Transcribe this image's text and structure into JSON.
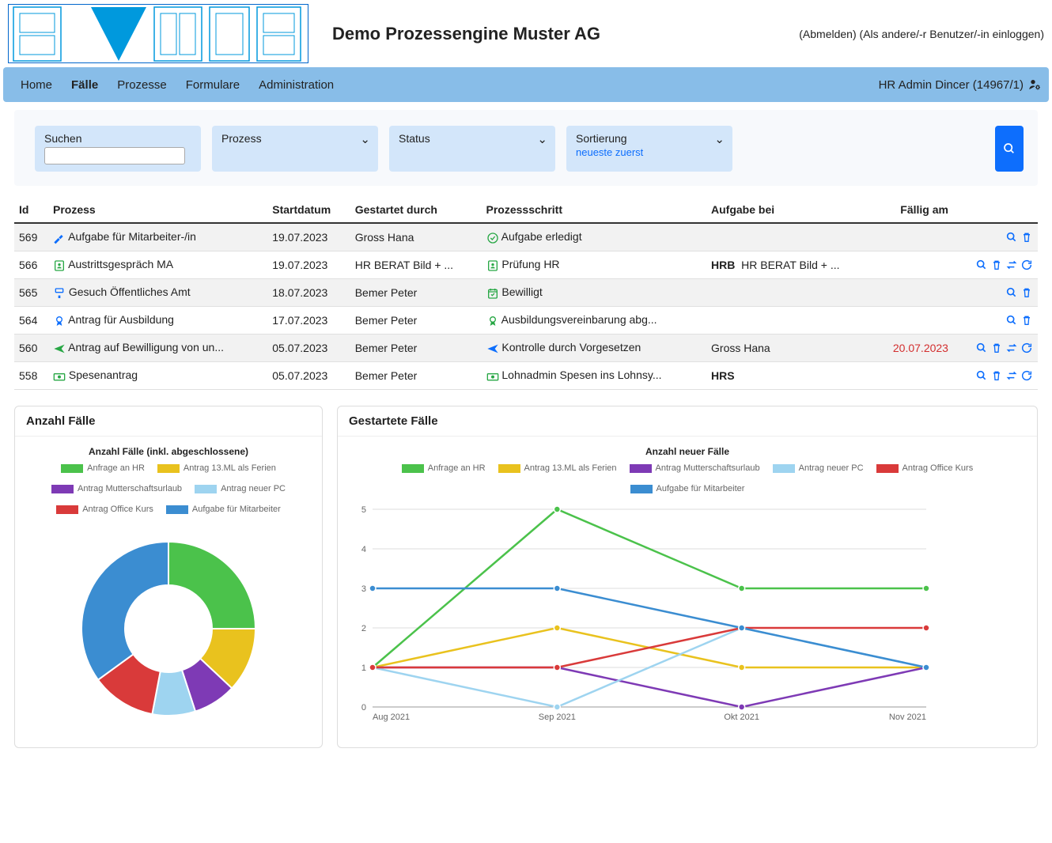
{
  "header": {
    "company": "Demo Prozessengine Muster AG",
    "logout": "(Abmelden)",
    "login_as": "(Als andere/-r Benutzer/-in einloggen)"
  },
  "nav": {
    "items": [
      "Home",
      "Fälle",
      "Prozesse",
      "Formulare",
      "Administration"
    ],
    "active_index": 1,
    "user": "HR Admin Dincer (14967/1)"
  },
  "filters": {
    "search_label": "Suchen",
    "process_label": "Prozess",
    "status_label": "Status",
    "sort_label": "Sortierung",
    "sort_value": "neueste zuerst"
  },
  "table": {
    "columns": [
      "Id",
      "Prozess",
      "Startdatum",
      "Gestartet durch",
      "Prozessschritt",
      "Aufgabe bei",
      "Fällig am"
    ],
    "rows": [
      {
        "id": "569",
        "prozess": "Aufgabe für Mitarbeiter-/in",
        "icon": "hammer",
        "icon_color": "#0d6efd",
        "start": "19.07.2023",
        "starter": "Gross Hana",
        "step": "Aufgabe erledigt",
        "step_icon": "check-circle",
        "step_color": "#28a745",
        "assignee_code": "",
        "assignee": "",
        "due": "",
        "overdue": false,
        "actions": [
          "search",
          "trash"
        ]
      },
      {
        "id": "566",
        "prozess": "Austrittsgespräch MA",
        "icon": "doc-user",
        "icon_color": "#28a745",
        "start": "19.07.2023",
        "starter": "HR BERAT Bild + ...",
        "step": "Prüfung HR",
        "step_icon": "doc-user",
        "step_color": "#28a745",
        "assignee_code": "HRB",
        "assignee": "HR BERAT Bild + ...",
        "due": "",
        "overdue": false,
        "actions": [
          "search",
          "trash",
          "exchange",
          "refresh"
        ]
      },
      {
        "id": "565",
        "prozess": "Gesuch Öffentliches Amt",
        "icon": "paint",
        "icon_color": "#0d6efd",
        "start": "18.07.2023",
        "starter": "Bemer Peter",
        "step": "Bewilligt",
        "step_icon": "cal-check",
        "step_color": "#28a745",
        "assignee_code": "",
        "assignee": "",
        "due": "",
        "overdue": false,
        "actions": [
          "search",
          "trash"
        ]
      },
      {
        "id": "564",
        "prozess": "Antrag für Ausbildung",
        "icon": "award",
        "icon_color": "#0d6efd",
        "start": "17.07.2023",
        "starter": "Bemer Peter",
        "step": "Ausbildungsvereinbarung abg...",
        "step_icon": "award",
        "step_color": "#28a745",
        "assignee_code": "",
        "assignee": "",
        "due": "",
        "overdue": false,
        "actions": [
          "search",
          "trash"
        ]
      },
      {
        "id": "560",
        "prozess": "Antrag auf Bewilligung von un...",
        "icon": "plane",
        "icon_color": "#28a745",
        "start": "05.07.2023",
        "starter": "Bemer Peter",
        "step": "Kontrolle durch Vorgesetzen",
        "step_icon": "plane",
        "step_color": "#0d6efd",
        "assignee_code": "",
        "assignee": "Gross Hana",
        "due": "20.07.2023",
        "overdue": true,
        "actions": [
          "search",
          "trash",
          "exchange",
          "refresh"
        ]
      },
      {
        "id": "558",
        "prozess": "Spesenantrag",
        "icon": "money",
        "icon_color": "#28a745",
        "start": "05.07.2023",
        "starter": "Bemer Peter",
        "step": "Lohnadmin Spesen ins Lohnsy...",
        "step_icon": "money",
        "step_color": "#28a745",
        "assignee_code": "HRS",
        "assignee": "",
        "due": "",
        "overdue": false,
        "actions": [
          "search",
          "trash",
          "exchange",
          "refresh"
        ]
      }
    ]
  },
  "charts": {
    "card1_title": "Anzahl Fälle",
    "card2_title": "Gestartete Fälle"
  },
  "chart_data": [
    {
      "type": "pie",
      "title": "Anzahl Fälle (inkl. abgeschlossene)",
      "series": [
        {
          "name": "Anfrage an HR",
          "color": "#4bc24b",
          "value": 25
        },
        {
          "name": "Antrag 13.ML als Ferien",
          "color": "#e9c21e",
          "value": 12
        },
        {
          "name": "Antrag Mutterschaftsurlaub",
          "color": "#7e3ab5",
          "value": 8
        },
        {
          "name": "Antrag neuer PC",
          "color": "#9ed4f0",
          "value": 8
        },
        {
          "name": "Antrag Office Kurs",
          "color": "#d93a3a",
          "value": 12
        },
        {
          "name": "Aufgabe für Mitarbeiter",
          "color": "#3b8dd1",
          "value": 35
        }
      ]
    },
    {
      "type": "line",
      "title": "Anzahl neuer Fälle",
      "x": [
        "Aug 2021",
        "Sep 2021",
        "Okt 2021",
        "Nov 2021"
      ],
      "ylim": [
        0,
        5
      ],
      "yticks": [
        0,
        1,
        2,
        3,
        4,
        5
      ],
      "series": [
        {
          "name": "Anfrage an HR",
          "color": "#4bc24b",
          "values": [
            1,
            5,
            3,
            3
          ]
        },
        {
          "name": "Antrag 13.ML als Ferien",
          "color": "#e9c21e",
          "values": [
            1,
            2,
            1,
            1
          ]
        },
        {
          "name": "Antrag Mutterschaftsurlaub",
          "color": "#7e3ab5",
          "values": [
            1,
            1,
            0,
            1
          ]
        },
        {
          "name": "Antrag neuer PC",
          "color": "#9ed4f0",
          "values": [
            1,
            0,
            2,
            1
          ]
        },
        {
          "name": "Antrag Office Kurs",
          "color": "#d93a3a",
          "values": [
            1,
            1,
            2,
            2
          ]
        },
        {
          "name": "Aufgabe für Mitarbeiter",
          "color": "#3b8dd1",
          "values": [
            3,
            3,
            2,
            1
          ]
        }
      ]
    }
  ]
}
